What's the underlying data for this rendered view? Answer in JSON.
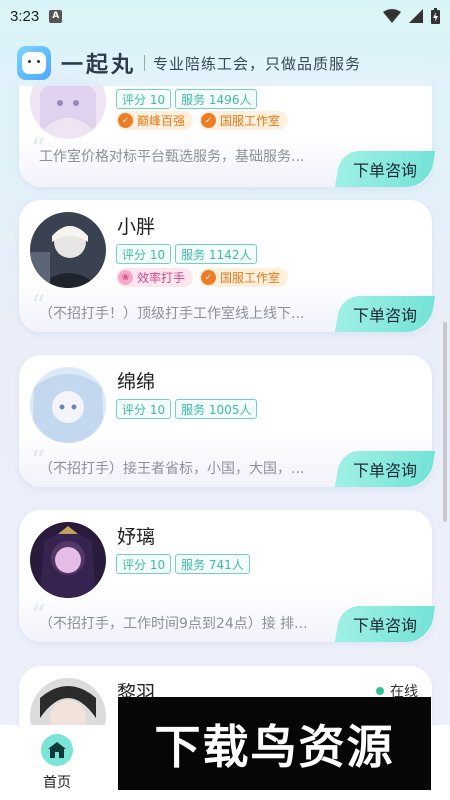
{
  "status_bar": {
    "time": "3:23",
    "notif_letter": "A"
  },
  "header": {
    "app_name": "一起丸",
    "slogan": "专业陪练工会，只做品质服务"
  },
  "order_label": "下单咨询",
  "cards": [
    {
      "name": "",
      "tags": [
        "评分 10",
        "服务 1496人"
      ],
      "badges": [
        {
          "label": "巅峰百强",
          "style": "orange"
        },
        {
          "label": "国服工作室",
          "style": "orange"
        }
      ],
      "desc": "工作室价格对标平台甄选服务，基础服务..."
    },
    {
      "name": "小胖",
      "tags": [
        "评分 10",
        "服务 1142人"
      ],
      "badges": [
        {
          "label": "效率打手",
          "style": "pink"
        },
        {
          "label": "国服工作室",
          "style": "orange"
        }
      ],
      "desc": "（不招打手！）顶级打手工作室线上线下..."
    },
    {
      "name": "绵绵",
      "tags": [
        "评分 10",
        "服务 1005人"
      ],
      "badges": [],
      "desc": "（不招打手）接王者省标，小国，大国，..."
    },
    {
      "name": "妤璃",
      "tags": [
        "评分 10",
        "服务 741人"
      ],
      "badges": [],
      "desc": "（不招打手，工作时间9点到24点）接 排..."
    },
    {
      "name": "黎羽",
      "status": "在线",
      "tags": [],
      "badges": [],
      "desc": ""
    }
  ],
  "bottom_nav": {
    "home_label": "首页"
  },
  "watermark": "下载鸟资源",
  "colors": {
    "accent": "#74e3d6",
    "tag": "#3dbba6",
    "badge_orange": "#e07a1a",
    "badge_pink": "#d0478c"
  }
}
